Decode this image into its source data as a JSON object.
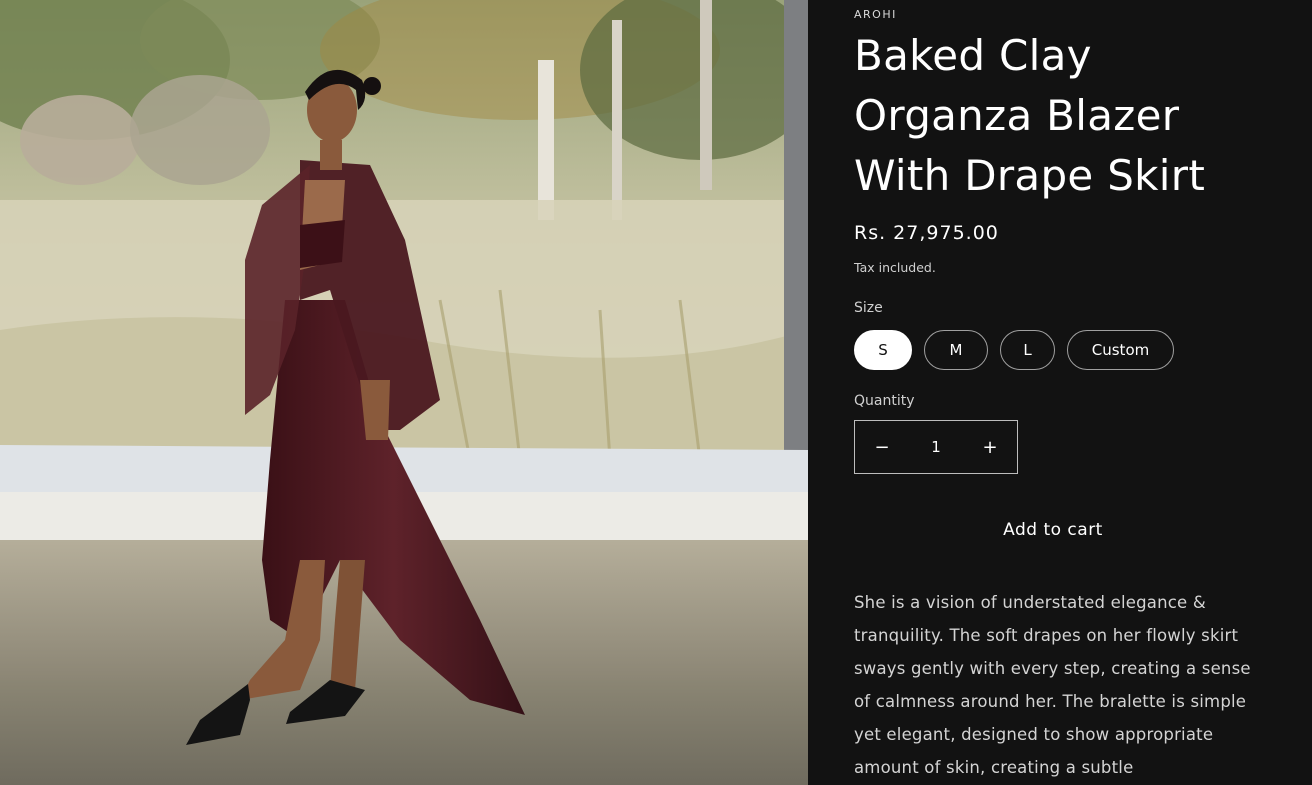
{
  "product": {
    "vendor": "AROHI",
    "title": "Baked Clay Organza Blazer With Drape Skirt",
    "price": "Rs. 27,975.00",
    "tax_note": "Tax included.",
    "size_label": "Size",
    "sizes": [
      "S",
      "M",
      "L",
      "Custom"
    ],
    "selected_size": "S",
    "quantity_label": "Quantity",
    "quantity": "1",
    "decrease_symbol": "−",
    "increase_symbol": "+",
    "add_to_cart": "Add to cart",
    "description": "She is a vision of understated elegance & tranquility. The soft drapes on her flowly skirt sways gently with every step, creating a sense of calmness around her. The bralette is simple yet elegant, designed to show appropriate amount of skin, creating a subtle"
  },
  "colors": {
    "background": "#121212",
    "garment": "#4a1820",
    "text": "#ffffff"
  }
}
